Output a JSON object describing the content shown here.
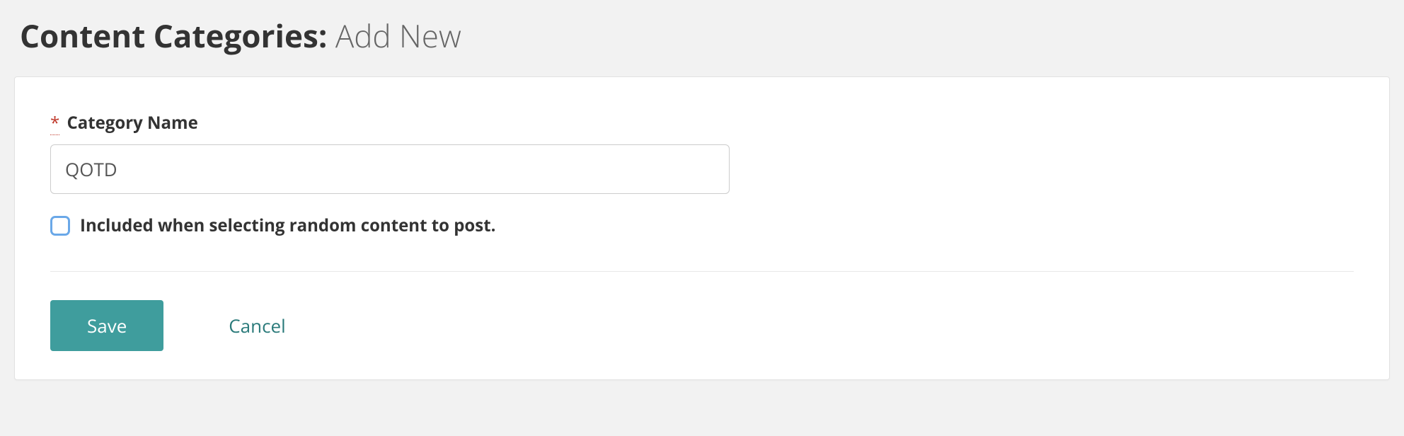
{
  "header": {
    "title_strong": "Content Categories:",
    "title_light": "Add New"
  },
  "form": {
    "required_marker": "*",
    "category_name_label": "Category Name",
    "category_name_value": "QOTD",
    "include_random_label": "Included when selecting random content to post."
  },
  "actions": {
    "save_label": "Save",
    "cancel_label": "Cancel"
  }
}
